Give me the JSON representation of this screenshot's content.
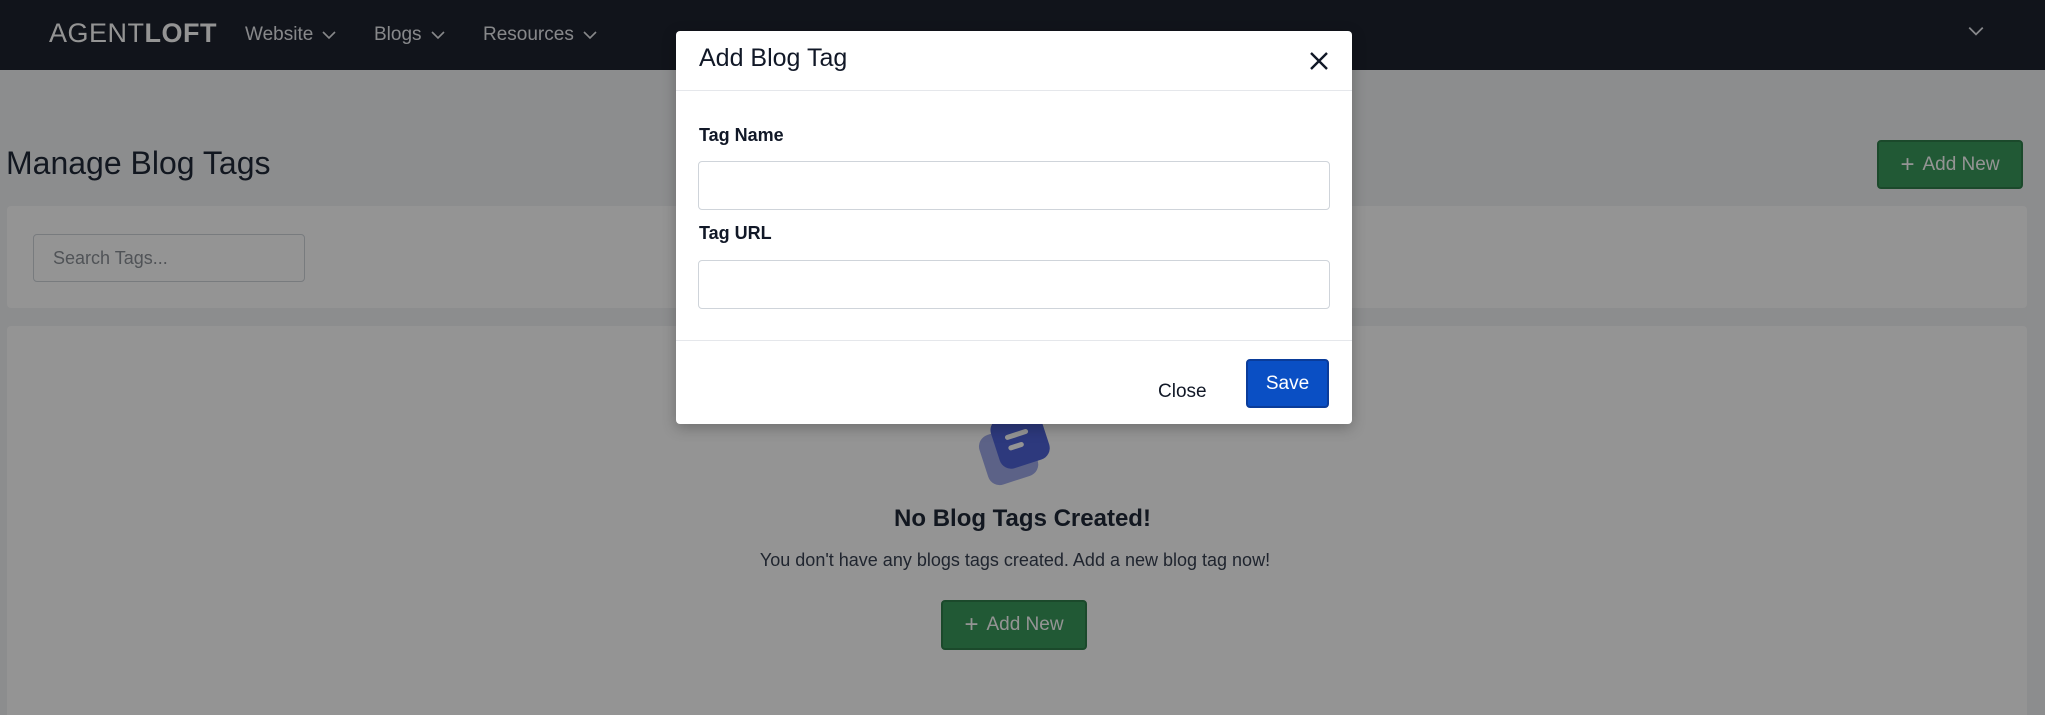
{
  "brand": {
    "logo_regular": "AGENT",
    "logo_bold": "LOFT"
  },
  "nav": {
    "items": [
      {
        "label": "Website"
      },
      {
        "label": "Blogs"
      },
      {
        "label": "Resources"
      }
    ]
  },
  "page": {
    "title": "Manage Blog Tags",
    "add_new_label": "Add New",
    "search_placeholder": "Search Tags..."
  },
  "empty_state": {
    "title": "No Blog Tags Created!",
    "subtitle": "You don't have any blogs tags created. Add a new blog tag now!",
    "add_new_label": "Add New"
  },
  "modal": {
    "title": "Add Blog Tag",
    "fields": [
      {
        "label": "Tag Name",
        "value": ""
      },
      {
        "label": "Tag URL",
        "value": ""
      }
    ],
    "close_label": "Close",
    "save_label": "Save"
  },
  "colors": {
    "nav_bg": "#1e2330",
    "add_button": "#3a9a5c",
    "save_button": "#0a4fc4",
    "empty_icon": "#4f63d8"
  },
  "icons": {
    "nav_chevron": "chevron-down-icon",
    "add": "plus-icon",
    "modal_close": "close-icon",
    "empty_state": "tags-icon"
  }
}
